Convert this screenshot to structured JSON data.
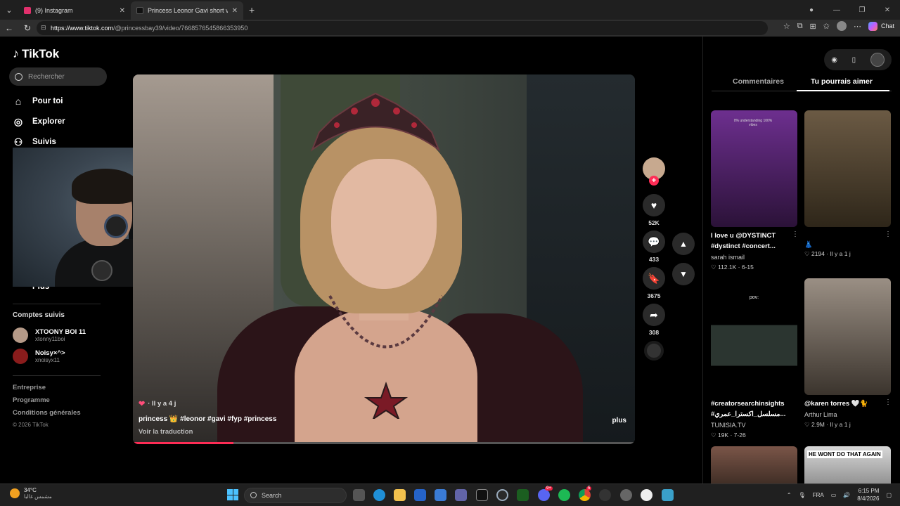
{
  "browser": {
    "tabs": [
      {
        "title": "(9) Instagram",
        "favicon_color": "#e1306c"
      },
      {
        "title": "Princess Leonor Gavi short video",
        "favicon_color": "#111111"
      }
    ],
    "url_host": "https://www.tiktok.com",
    "url_path": "/@princessbay39/video/7668576545866353950",
    "chat_label": "Chat"
  },
  "sidebar": {
    "logo": "TikTok",
    "search_placeholder": "Rechercher",
    "nav": [
      {
        "label": "Pour toi",
        "icon": "home-icon"
      },
      {
        "label": "Explorer",
        "icon": "compass-icon"
      },
      {
        "label": "Suivis",
        "icon": "users-icon"
      },
      {
        "label": "Plus",
        "icon": "more-icon"
      }
    ],
    "following_title": "Comptes suivis",
    "following": [
      {
        "name": "XTOONY BOI 11",
        "handle": "xtonny11boi",
        "avatar_color": "#b59a88"
      },
      {
        "name": "Noisy×^>",
        "handle": "xnoisyx11",
        "avatar_color": "#8a1c1c"
      }
    ],
    "footer_links": [
      "Entreprise",
      "Programme",
      "Conditions générales"
    ],
    "copyright": "© 2026 TikTok"
  },
  "video": {
    "meta_time": "· Il y a 4 j",
    "caption": "princess 👑 #leonor #gavi #fyp #princess",
    "translate": "Voir la traduction",
    "more": "plus",
    "progress": 0.2
  },
  "actions": {
    "likes": "52K",
    "comments": "433",
    "saves": "3675",
    "shares": "308"
  },
  "right_panel": {
    "tabs": {
      "comments": "Commentaires",
      "suggested": "Tu pourrais aimer"
    },
    "cards": [
      {
        "title": "I love u @DYSTINCT #dystinct #concert...",
        "author": "sarah ismail",
        "stats": "♡ 112.1K · 6-15",
        "thumb_top": "#6d2f8f",
        "thumb_bottom": "#2b1238",
        "overlay": "0% understanding 100% vibes"
      },
      {
        "title": "👗",
        "author": "",
        "stats": "♡ 2194 · Il y a 1 j",
        "thumb_top": "#6b5a44",
        "thumb_bottom": "#2e2619",
        "overlay": ""
      },
      {
        "title": "#creatorsearchinsights #مسلسل_اكسترا_عمري...",
        "author": "TUNISIA.TV",
        "stats": "♡ 19K · 7-26",
        "thumb_top": "#000000",
        "thumb_bottom": "#2b3530",
        "overlay": "pov:"
      },
      {
        "title": "@karen torres 🤍🐈",
        "author": "Arthur Lima",
        "stats": "♡ 2.9M · Il y a 1 j",
        "thumb_top": "#9a8f84",
        "thumb_bottom": "#3b342d",
        "overlay": ""
      },
      {
        "title": "",
        "author": "",
        "stats": "",
        "thumb_top": "#7a5548",
        "thumb_bottom": "#3a2a22",
        "overlay": ""
      },
      {
        "title": "",
        "author": "",
        "stats": "",
        "thumb_top": "#d8d8d8",
        "thumb_bottom": "#8a8a8a",
        "overlay": "HE WONT DO THAT AGAIN"
      }
    ]
  },
  "taskbar": {
    "temp": "34°C",
    "weather_desc": "مشمس غالبا",
    "search_label": "Search",
    "lang": "FRA",
    "time": "6:15 PM",
    "date": "8/4/2026",
    "badges": {
      "discord": "9+",
      "chrome": "5"
    }
  }
}
